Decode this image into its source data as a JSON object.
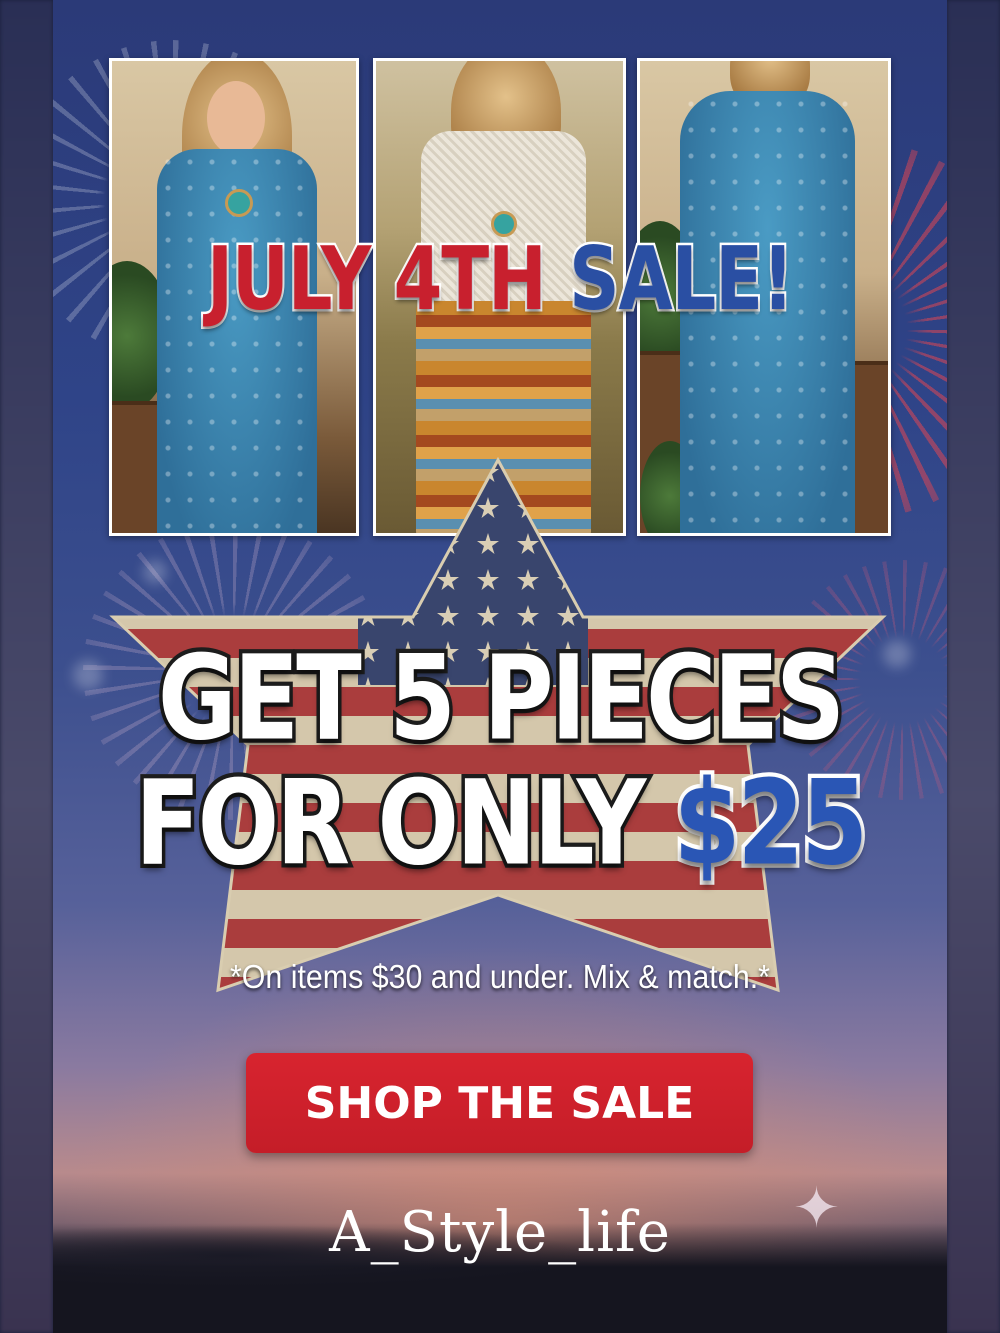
{
  "headline": {
    "part1": "JULY 4TH",
    "part2": "SALE!"
  },
  "offer": {
    "line1": "GET 5 PIECES",
    "line2_prefix": "FOR ONLY",
    "price": "$25"
  },
  "fine_print": "*On items $30 and under. Mix & match.*",
  "cta": {
    "label": "SHOP THE SALE"
  },
  "brand": "A_Style_life",
  "photos": [
    {
      "subject": "blue-embroidered-maxi-dress-front"
    },
    {
      "subject": "crochet-top-with-feather-print-skirt"
    },
    {
      "subject": "blue-embroidered-maxi-dress-back"
    }
  ],
  "colors": {
    "headline_red": "#c8202e",
    "headline_blue": "#2a4fa3",
    "price_blue": "#2a56b5",
    "cta_red": "#d8242f",
    "flag_red": "#b5343a",
    "flag_cream": "#e8dcc0",
    "flag_navy": "#2b3d74"
  },
  "icons": {
    "sparkle": "sparkle-icon",
    "star": "flag-star-graphic"
  }
}
